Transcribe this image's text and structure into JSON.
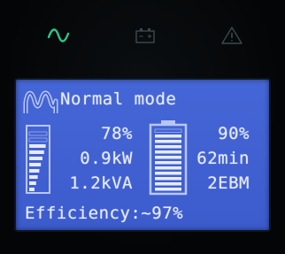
{
  "indicators": {
    "ac_icon": "sine-wave-icon",
    "battery_icon": "battery-icon",
    "alarm_icon": "warning-triangle-icon",
    "ac_color": "#27c98a",
    "idle_color": "#3a4a4e"
  },
  "lcd": {
    "mode_icon": "sine-wave-icon",
    "mode": "Normal mode",
    "load_percent": "78%",
    "output_power": "0.9kW",
    "apparent_power": "1.2kVA",
    "battery_percent": "90%",
    "runtime": "62min",
    "battery_modules": "2EBM",
    "efficiency": "Efficiency:~97%",
    "load_level": 0.78,
    "battery_level": 0.9,
    "background_color": "#4262d3",
    "text_color": "#e6ebff"
  }
}
